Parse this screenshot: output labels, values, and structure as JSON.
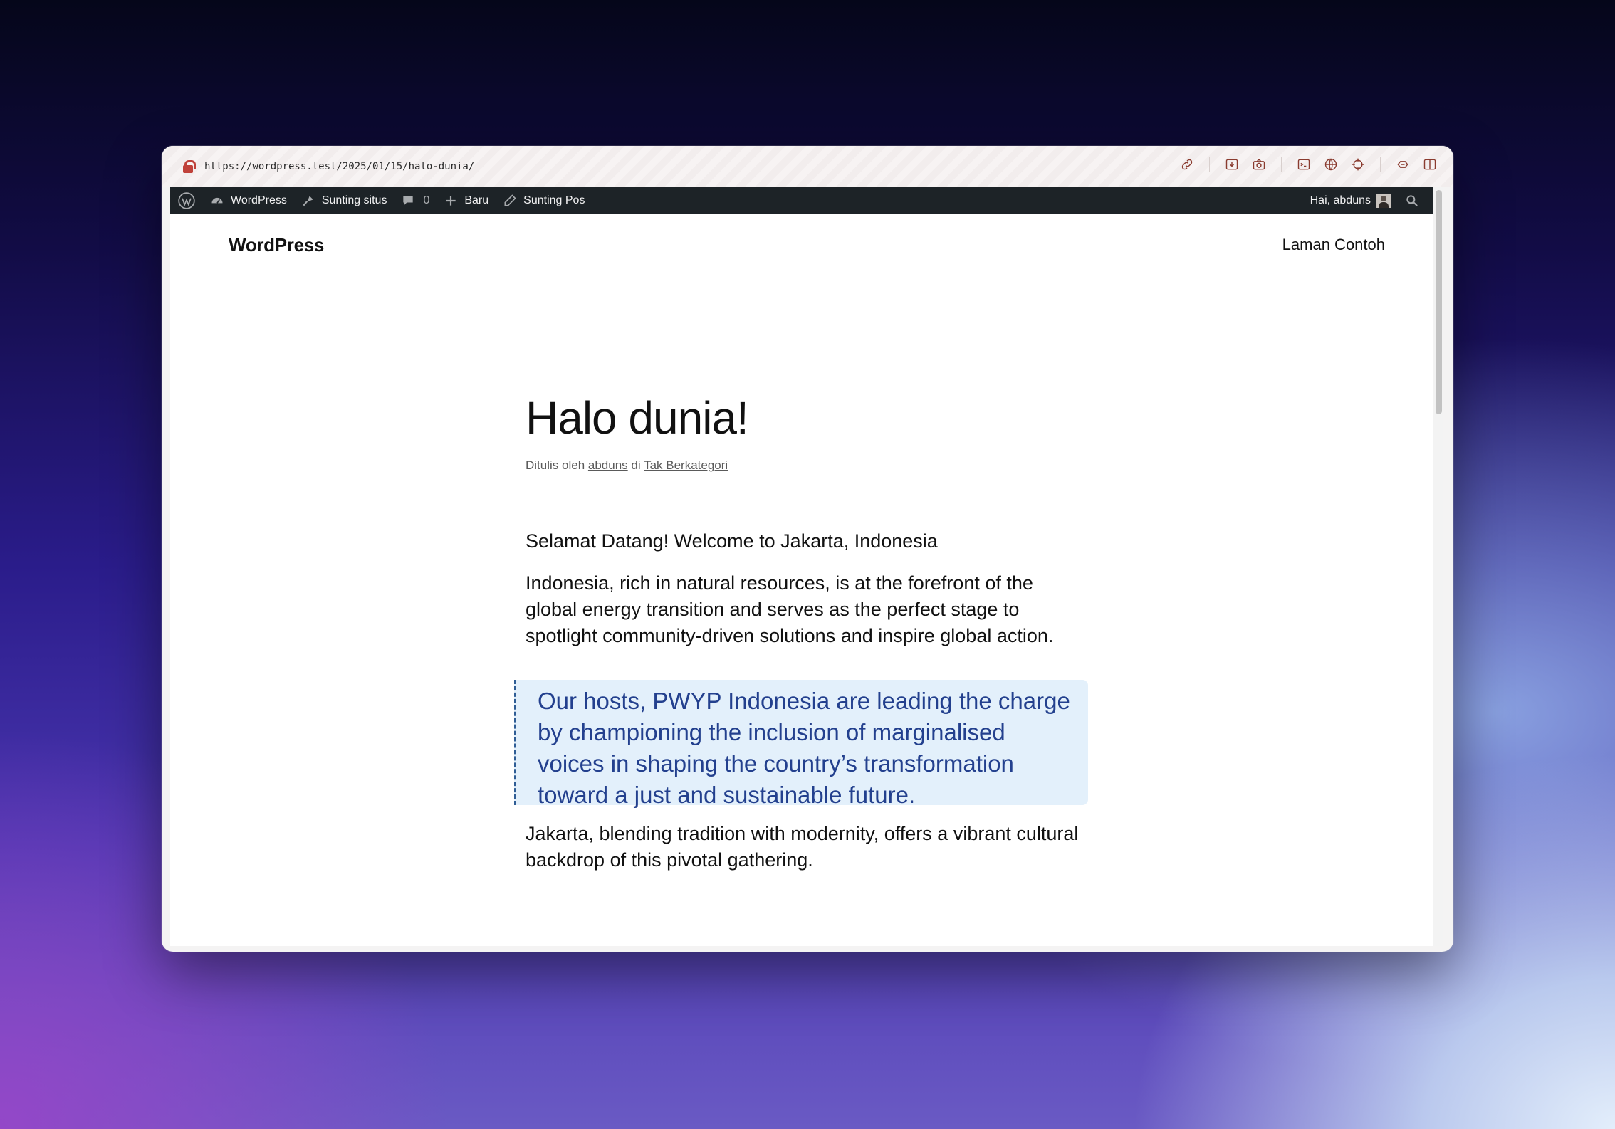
{
  "browser": {
    "url": "https://wordpress.test/2025/01/15/halo-dunia/",
    "toolbar_icons": [
      "link-icon",
      "download-icon",
      "camera-icon",
      "terminal-icon",
      "globe-icon",
      "crosshair-icon",
      "extensions-icon",
      "sidebar-toggle-icon"
    ]
  },
  "admin_bar": {
    "site_name": "WordPress",
    "customize": "Sunting situs",
    "comments_count": "0",
    "new": "Baru",
    "edit_post": "Sunting Pos",
    "greeting": "Hai, abduns"
  },
  "site": {
    "title": "WordPress",
    "nav_page": "Laman Contoh"
  },
  "post": {
    "title": "Halo dunia!",
    "meta_prefix": "Ditulis oleh",
    "author": "abduns",
    "meta_in": "di",
    "category": "Tak Berkategori",
    "paragraph1": "Selamat Datang! Welcome to Jakarta, Indonesia",
    "paragraph2": "Indonesia, rich in natural resources, is at the forefront of the global energy transition and serves as the perfect stage to spotlight community-driven solutions and inspire global action.",
    "quote": "Our hosts, PWYP Indonesia are leading the charge by championing the inclusion of marginalised voices in shaping the country’s transformation toward a just and sustainable future.",
    "paragraph3": "Jakarta, blending tradition with modernity, offers a vibrant cultural backdrop of this pivotal gathering."
  },
  "colors": {
    "admin_bar_bg": "#1d2327",
    "quote_bg": "#e3f0fb",
    "quote_text": "#23408e",
    "toolbar_icon": "#8a3b2f"
  }
}
